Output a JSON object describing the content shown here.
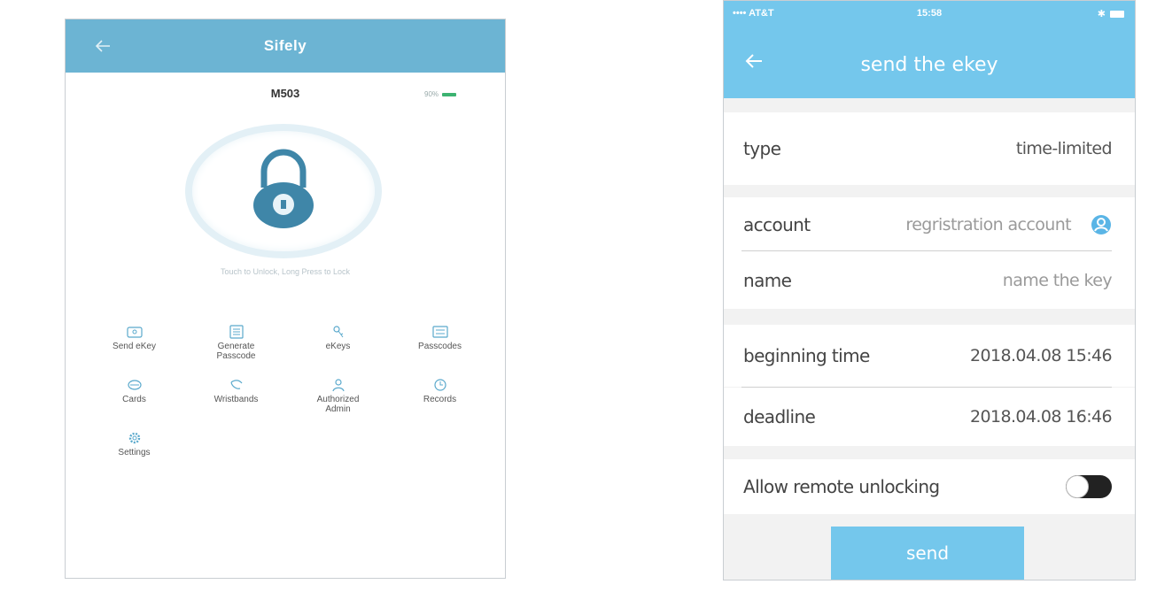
{
  "left_screen": {
    "title": "Sifely",
    "lock_name": "M503",
    "battery_text": "90%",
    "unlock_hint": "Touch to Unlock, Long Press to Lock",
    "colors": {
      "header": "#6cb4d3",
      "battery": "#3cb371"
    },
    "menu": [
      {
        "label": "Send eKey",
        "icon": "send-ekey-icon"
      },
      {
        "label": "Generate\nPasscode",
        "icon": "keypad-icon"
      },
      {
        "label": "eKeys",
        "icon": "ekeys-icon"
      },
      {
        "label": "Passcodes",
        "icon": "passcodes-icon"
      },
      {
        "label": "Cards",
        "icon": "card-icon"
      },
      {
        "label": "Wristbands",
        "icon": "wristband-icon"
      },
      {
        "label": "Authorized\nAdmin",
        "icon": "admin-icon"
      },
      {
        "label": "Records",
        "icon": "clock-icon"
      },
      {
        "label": "Settings",
        "icon": "gear-icon"
      }
    ]
  },
  "right_screen": {
    "status": {
      "carrier": "AT&T",
      "time": "15:58"
    },
    "title": "send the ekey",
    "colors": {
      "accent": "#74c7ec"
    },
    "type": {
      "label": "type",
      "value": "time-limited"
    },
    "account": {
      "label": "account",
      "placeholder": "regristration account"
    },
    "name": {
      "label": "name",
      "placeholder": "name the key"
    },
    "begin": {
      "label": "beginning time",
      "value": "2018.04.08 15:46"
    },
    "deadline": {
      "label": "deadline",
      "value": "2018.04.08 16:46"
    },
    "remote": {
      "label": "Allow remote unlocking",
      "enabled": false
    },
    "send_label": "send"
  }
}
